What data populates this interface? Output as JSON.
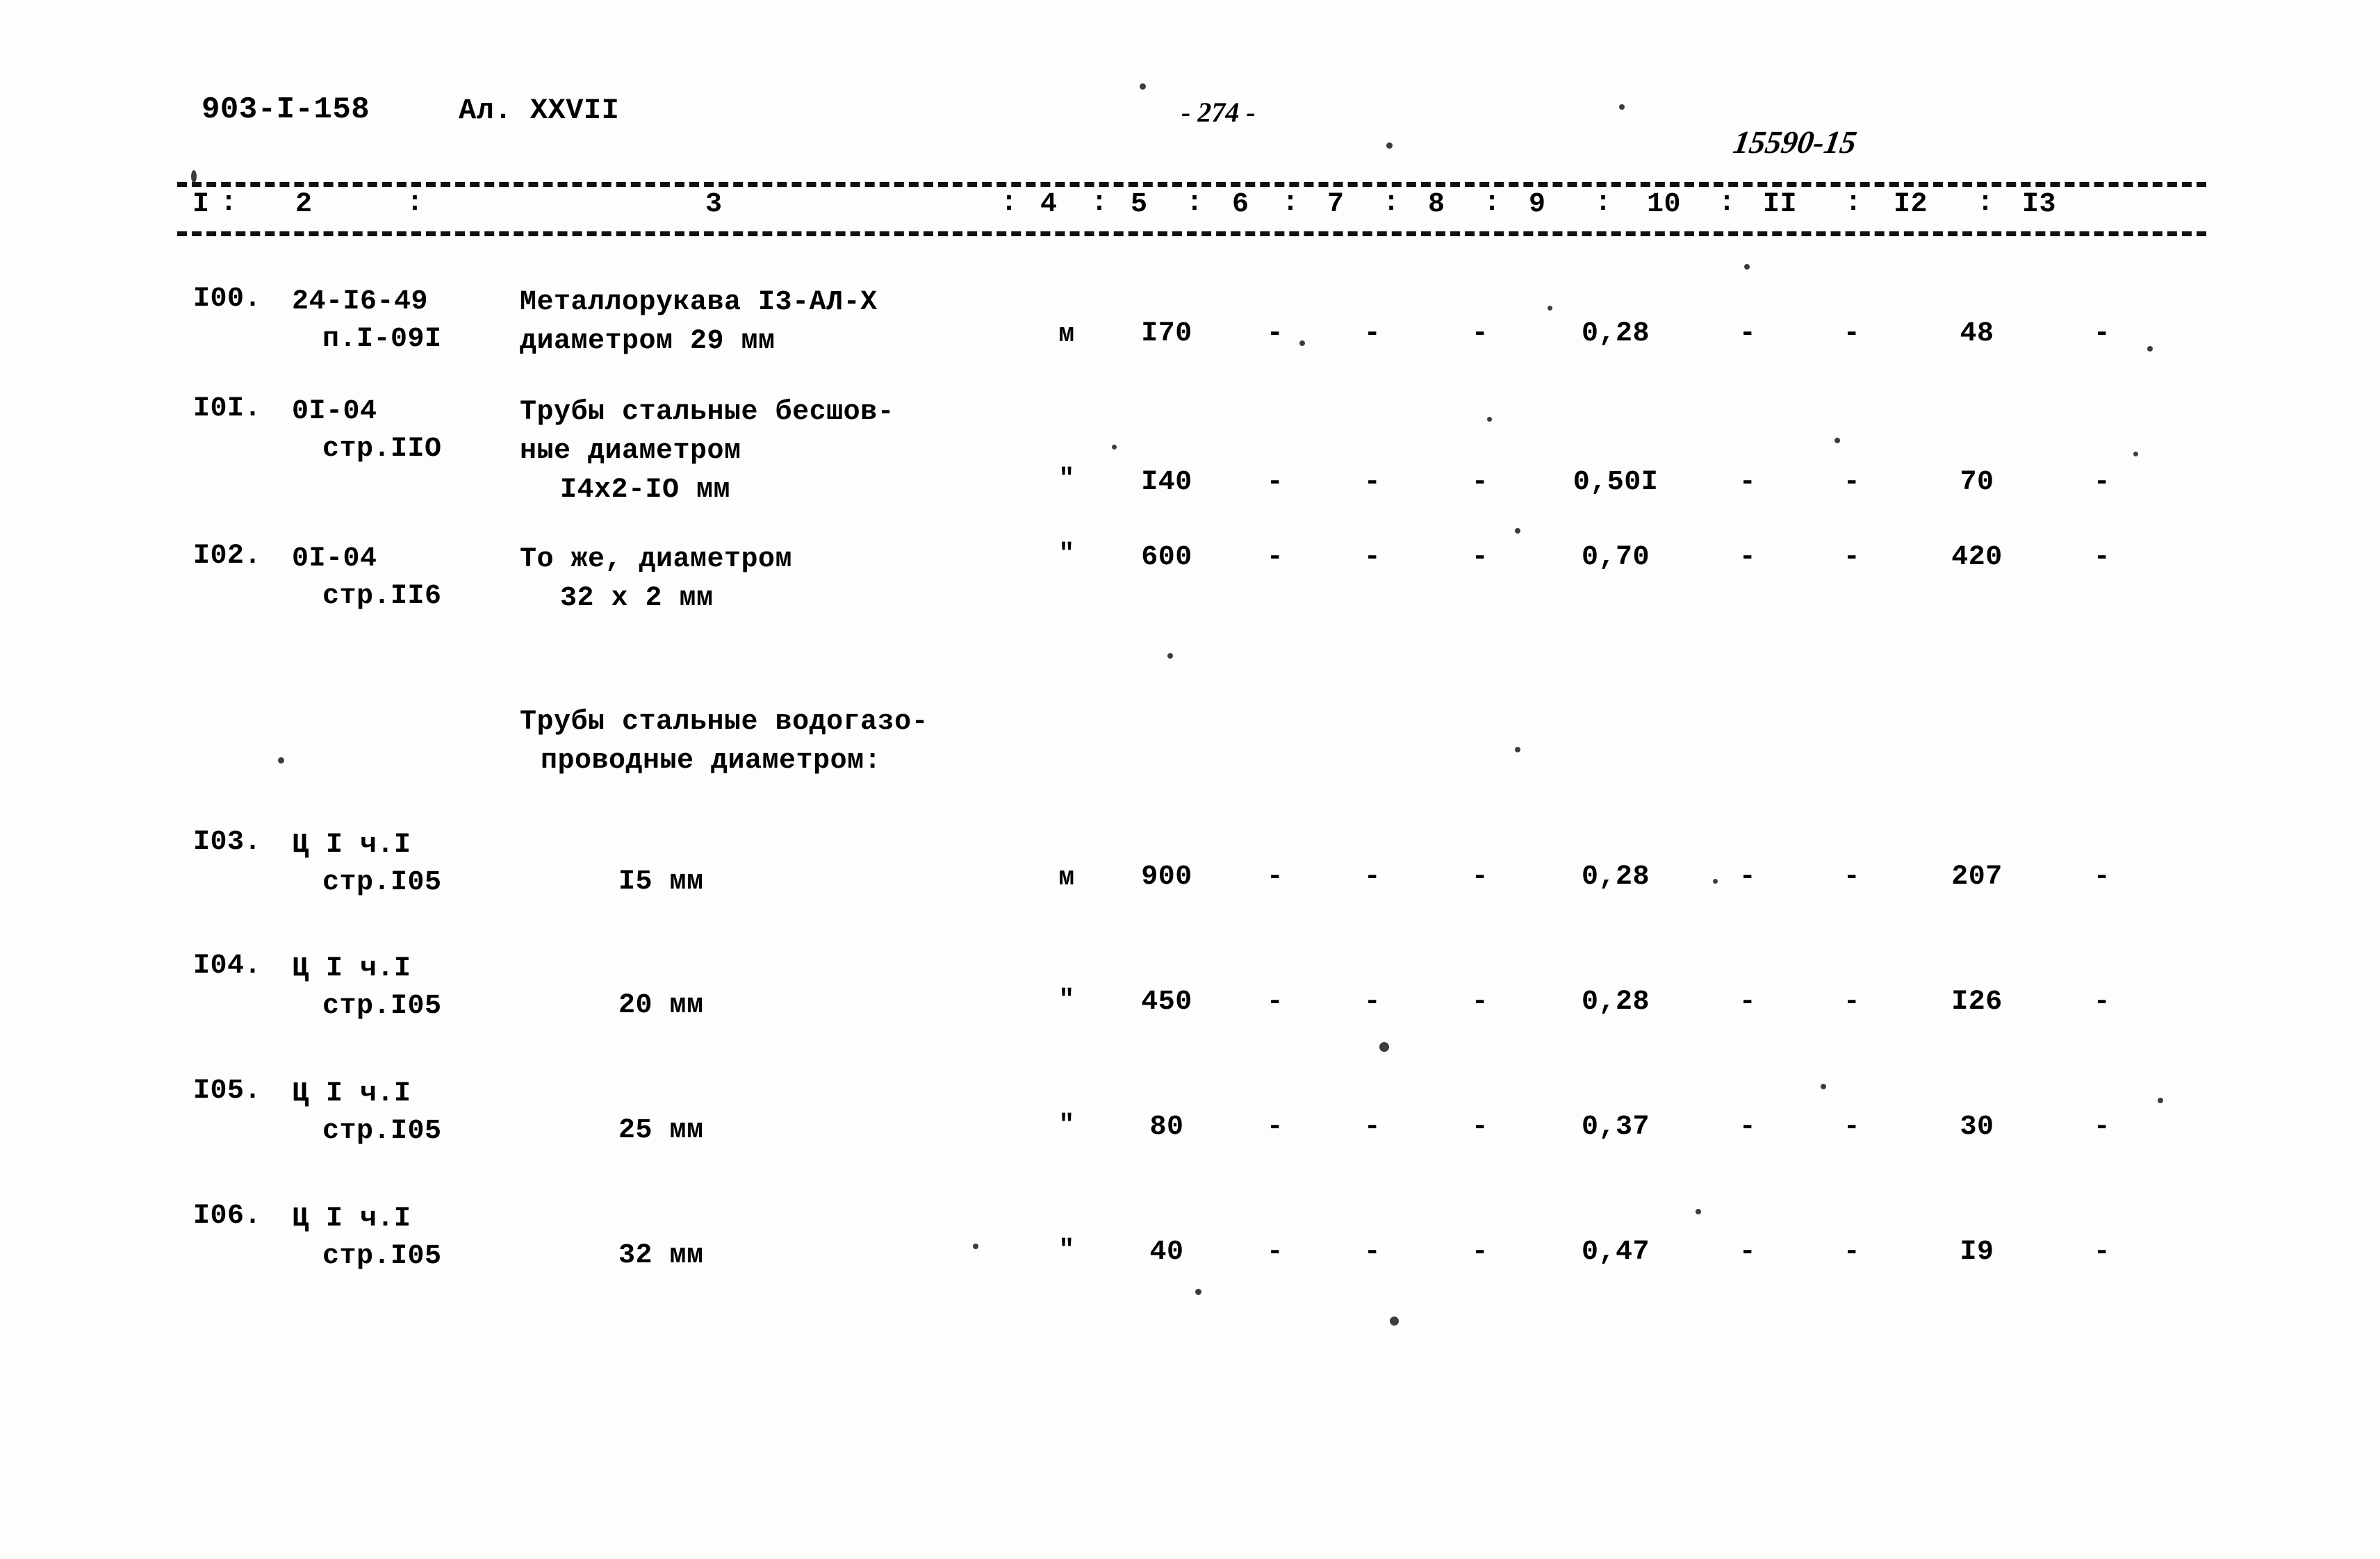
{
  "header": {
    "doc_code": "903-I-158",
    "album": "Ал. XXVII",
    "page_number": "- 274 -",
    "stamp": "15590-15"
  },
  "table": {
    "column_numbers": [
      "I",
      "2",
      "3",
      "4",
      "5",
      "6",
      "7",
      "8",
      "9",
      "10",
      "II",
      "I2",
      "I3"
    ],
    "group_heading_line1": "Трубы стальные водогазо-",
    "group_heading_line2": "проводные диаметром:",
    "rows": [
      {
        "no": "I00.",
        "ref_line1": "24-I6-49",
        "ref_line2": "п.I-09I",
        "name_line1": "Металлорукава I3-АЛ-X",
        "name_line2": "диаметром 29 мм",
        "name_line3": "",
        "unit": "м",
        "qty": "I70",
        "c6": "-",
        "c7": "-",
        "c8": "-",
        "c9": "0,28",
        "c10": "-",
        "c11": "-",
        "c12": "48",
        "c13": "-"
      },
      {
        "no": "I0I.",
        "ref_line1": "0I-04",
        "ref_line2": "стр.IIO",
        "name_line1": "Трубы стальные бесшов-",
        "name_line2": "ные диаметром",
        "name_line3": "I4х2-IО мм",
        "unit": "\"",
        "qty": "I40",
        "c6": "-",
        "c7": "-",
        "c8": "-",
        "c9": "0,50I",
        "c10": "-",
        "c11": "-",
        "c12": "70",
        "c13": "-"
      },
      {
        "no": "I02.",
        "ref_line1": "0I-04",
        "ref_line2": "стр.II6",
        "name_line1": "То же, диаметром",
        "name_line2": "32 х 2 мм",
        "name_line3": "",
        "unit": "\"",
        "qty": "600",
        "c6": "-",
        "c7": "-",
        "c8": "-",
        "c9": "0,70",
        "c10": "-",
        "c11": "-",
        "c12": "420",
        "c13": "-"
      },
      {
        "no": "I03.",
        "ref_line1": "Ц I ч.I",
        "ref_line2": "стр.I05",
        "name_line1": "I5 мм",
        "name_line2": "",
        "name_line3": "",
        "unit": "м",
        "qty": "900",
        "c6": "-",
        "c7": "-",
        "c8": "-",
        "c9": "0,28",
        "c10": "-",
        "c11": "-",
        "c12": "207",
        "c13": "-"
      },
      {
        "no": "I04.",
        "ref_line1": "Ц I ч.I",
        "ref_line2": "стр.I05",
        "name_line1": "20 мм",
        "name_line2": "",
        "name_line3": "",
        "unit": "\"",
        "qty": "450",
        "c6": "-",
        "c7": "-",
        "c8": "-",
        "c9": "0,28",
        "c10": "-",
        "c11": "-",
        "c12": "I26",
        "c13": "-"
      },
      {
        "no": "I05.",
        "ref_line1": "Ц I ч.I",
        "ref_line2": "стр.I05",
        "name_line1": "25 мм",
        "name_line2": "",
        "name_line3": "",
        "unit": "\"",
        "qty": "80",
        "c6": "-",
        "c7": "-",
        "c8": "-",
        "c9": "0,37",
        "c10": "-",
        "c11": "-",
        "c12": "30",
        "c13": "-"
      },
      {
        "no": "I06.",
        "ref_line1": "Ц I ч.I",
        "ref_line2": "стр.I05",
        "name_line1": "32 мм",
        "name_line2": "",
        "name_line3": "",
        "unit": "\"",
        "qty": "40",
        "c6": "-",
        "c7": "-",
        "c8": "-",
        "c9": "0,47",
        "c10": "-",
        "c11": "-",
        "c12": "I9",
        "c13": "-"
      }
    ]
  }
}
